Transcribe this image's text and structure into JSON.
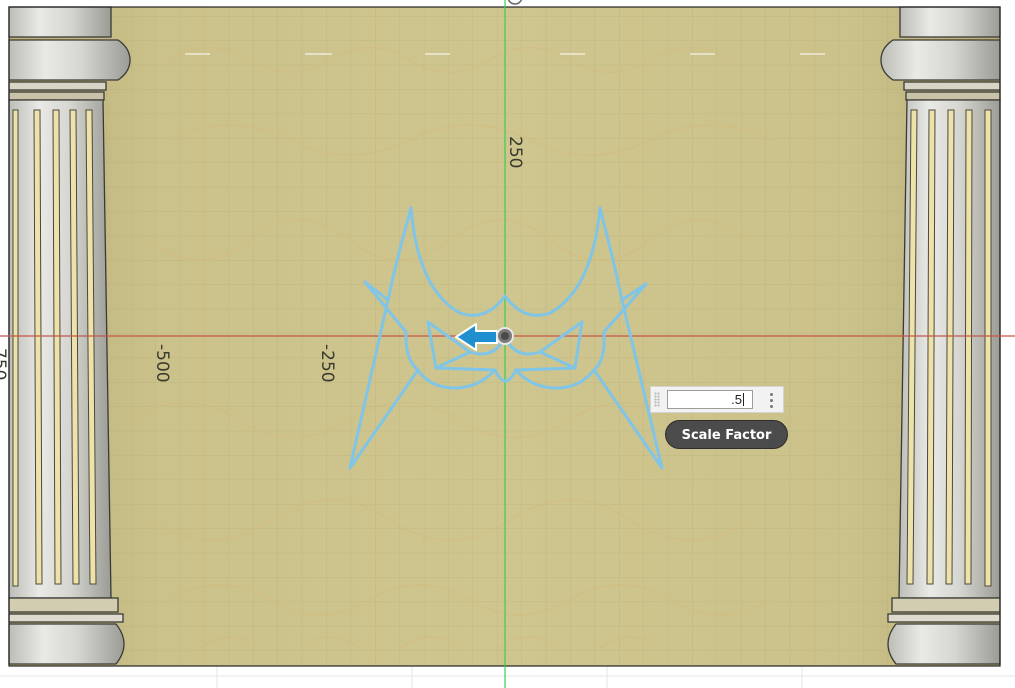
{
  "canvas": {
    "axis_labels": {
      "y_250": "250",
      "x_minus_250": "-250",
      "x_minus_500": "-500",
      "x_minus_750_partial": "750"
    }
  },
  "scale_dialog": {
    "input_value": ".5",
    "tooltip_label": "Scale Factor",
    "menu_icon": "vertical-ellipsis-icon"
  },
  "manipulator": {
    "arrow_icon": "left-arrow-icon",
    "arrow_color": "#1f8fd0",
    "origin_icon": "point-handle-icon"
  },
  "colors": {
    "panel": "#c7bd86",
    "sketch": "#7fc5e8",
    "x_axis": "#c8554a",
    "y_axis": "#3ccf4e"
  }
}
